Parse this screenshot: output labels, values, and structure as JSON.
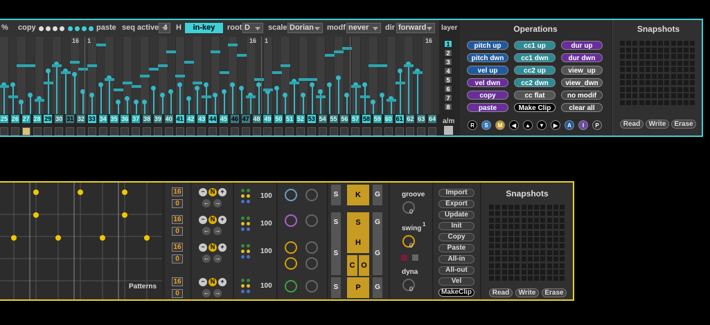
{
  "seq": {
    "zoom_label": "%",
    "copy_label": "copy",
    "paste_label": "paste",
    "seq_active_label": "seq active",
    "seq_active_value": "4",
    "h_label": "H",
    "inkey_label": "in-key",
    "root_label": "root",
    "root_value": "D",
    "scale_label": "scale",
    "scale_value": "Dorian",
    "modf_label": "modf",
    "modf_value": "never",
    "dir_label": "dir",
    "dir_value": "forward",
    "layer_label": "layer",
    "am_label": "a/m",
    "layers": [
      "1",
      "2",
      "3",
      "4",
      "5",
      "6",
      "7",
      "8"
    ],
    "active_layer": "1",
    "markers": [
      "16",
      "1",
      "16",
      "1",
      "16"
    ],
    "steps": [
      "25",
      "26",
      "27",
      "28",
      "29",
      "30",
      "31",
      "32",
      "33",
      "34",
      "35",
      "36",
      "37",
      "38",
      "39",
      "40",
      "41",
      "42",
      "43",
      "44",
      "45",
      "46",
      "47",
      "48",
      "49",
      "50",
      "51",
      "52",
      "53",
      "54",
      "55",
      "56",
      "57",
      "58",
      "59",
      "60",
      "61",
      "62",
      "63",
      "64"
    ]
  },
  "operations": {
    "title": "Operations",
    "buttons": [
      "pitch up",
      "cc1 up",
      "dur up",
      "pitch dwn",
      "cc1 dwn",
      "dur dwn",
      "vel up",
      "cc2 up",
      "view_up",
      "vel dwn",
      "cc2 dwn",
      "view_dwn",
      "copy",
      "cc flat",
      "no modif",
      "paste",
      "Make Clip",
      "clear all"
    ],
    "icons": [
      "R",
      "S",
      "M",
      "◀",
      "▲",
      "▼",
      "▶",
      "A",
      "I",
      "P"
    ]
  },
  "snapshots_top": {
    "title": "Snapshots",
    "read": "Read",
    "write": "Write",
    "erase": "Erase"
  },
  "drum": {
    "patterns_label": "Patterns",
    "rows": [
      {
        "len": "16",
        "off": "0",
        "vel": "100"
      },
      {
        "len": "16",
        "off": "0",
        "vel": "100"
      },
      {
        "len": "16",
        "off": "0",
        "vel": "100"
      },
      {
        "len": "16",
        "off": "0",
        "vel": "100"
      }
    ],
    "n_label": "N",
    "kit": [
      "K",
      "S",
      "H",
      "C",
      "O",
      "P"
    ],
    "s_label": "S",
    "g_label": "G",
    "groove_label": "groove",
    "groove_value": "0",
    "swing_label": "swing",
    "swing_value": "0",
    "swing_sup": "1",
    "dyna_label": "dyna",
    "dyna_value": "0",
    "actions": [
      "Import",
      "Export",
      "Update",
      "Init",
      "Copy",
      "Paste",
      "All-in",
      "All-out",
      "Vel",
      "MakeClip"
    ]
  },
  "snapshots_bottom": {
    "title": "Snapshots",
    "read": "Read",
    "write": "Write",
    "erase": "Erase"
  },
  "colors": {
    "cyan": "#3fd0d8",
    "yellow": "#e8d12c",
    "teal_button": "#35b8c8",
    "amber": "#c89b22"
  }
}
